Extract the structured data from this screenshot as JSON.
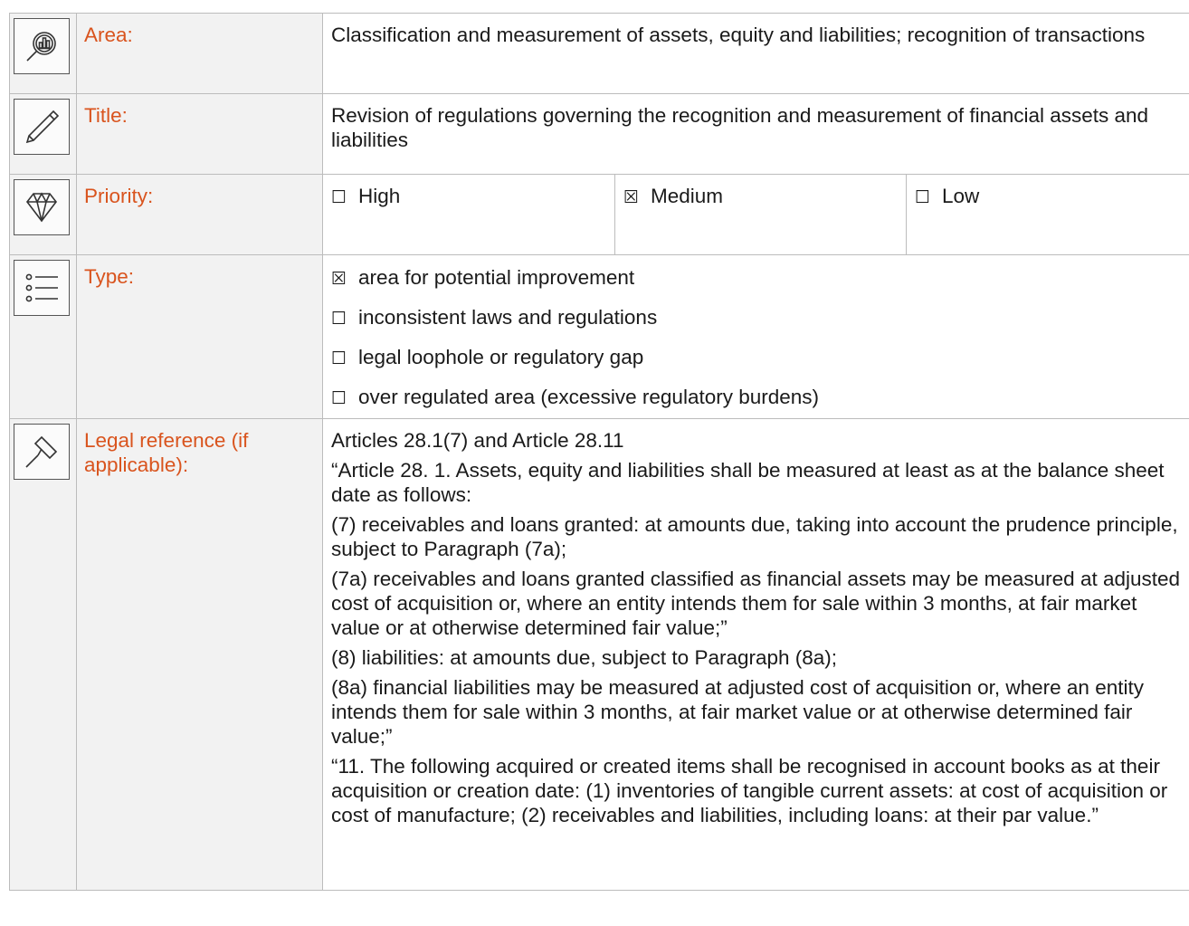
{
  "rows": {
    "area": {
      "icon": "analytics-magnifier-icon",
      "label": "Area:",
      "value": "Classification and measurement of assets, equity and liabilities; recognition of transactions"
    },
    "title": {
      "icon": "pencil-icon",
      "label": "Title:",
      "value": "Revision of regulations governing the recognition and measurement of financial assets and liabilities"
    },
    "priority": {
      "icon": "diamond-icon",
      "label": "Priority:",
      "options": [
        {
          "box": "☐",
          "label": "High"
        },
        {
          "box": "☒",
          "label": "Medium"
        },
        {
          "box": "☐",
          "label": "Low"
        }
      ]
    },
    "type": {
      "icon": "list-icon",
      "label": "Type:",
      "options": [
        {
          "box": "☒",
          "label": "area for potential improvement"
        },
        {
          "box": "☐",
          "label": "inconsistent laws and regulations"
        },
        {
          "box": "☐",
          "label": "legal loophole or regulatory gap"
        },
        {
          "box": "☐",
          "label": "over regulated area (excessive regulatory burdens)"
        }
      ]
    },
    "legal": {
      "icon": "gavel-icon",
      "label": "Legal reference (if applicable):",
      "paragraphs": [
        "Articles 28.1(7) and Article 28.11",
        "“Article 28. 1. Assets, equity and liabilities shall be measured at least as at the balance sheet date as follows:",
        "(7) receivables and loans granted: at amounts due, taking into account the prudence principle, subject to Paragraph (7a);",
        "(7a) receivables and loans granted classified as financial assets may be measured at adjusted cost of acquisition or, where an entity intends them for sale within 3 months, at fair market value or at otherwise determined fair value;”",
        "(8) liabilities: at amounts due, subject to Paragraph (8a);",
        "(8a) financial liabilities may be measured at adjusted cost of acquisition or, where an entity intends them for sale within 3 months, at fair market value or at otherwise determined fair value;”",
        "“11. The following acquired or created items shall be recognised in account books as at their acquisition or creation date: (1) inventories of tangible current assets: at cost of acquisition or cost of manufacture; (2) receivables and liabilities, including loans: at their par value.”"
      ]
    }
  }
}
